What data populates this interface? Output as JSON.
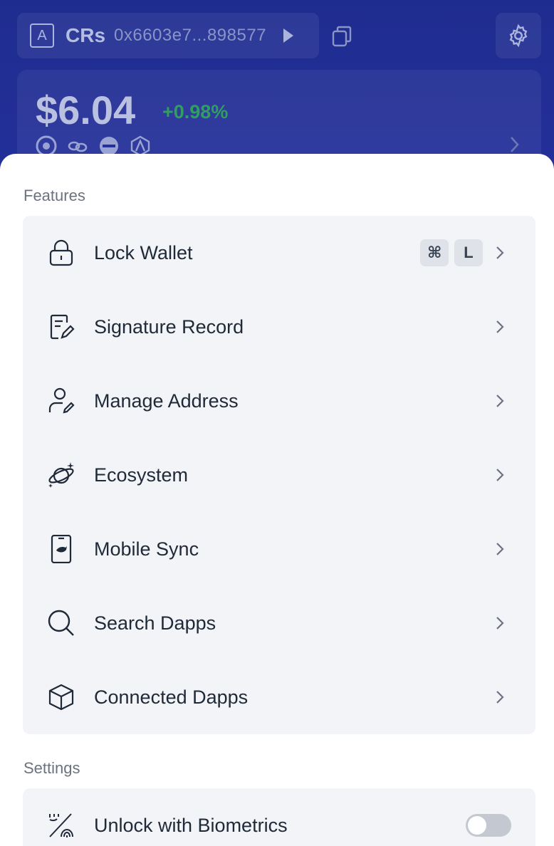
{
  "header": {
    "account_badge": "A",
    "account_name": "CRs",
    "account_address": "0x6603e7...898577",
    "balance": "$6.04",
    "change": "+0.98%"
  },
  "features": {
    "title": "Features",
    "items": [
      {
        "label": "Lock Wallet",
        "icon": "lock-icon",
        "shortcut": [
          "⌘",
          "L"
        ]
      },
      {
        "label": "Signature Record",
        "icon": "signature-record-icon"
      },
      {
        "label": "Manage Address",
        "icon": "user-edit-icon"
      },
      {
        "label": "Ecosystem",
        "icon": "planet-icon"
      },
      {
        "label": "Mobile Sync",
        "icon": "mobile-icon"
      },
      {
        "label": "Search Dapps",
        "icon": "search-icon"
      },
      {
        "label": "Connected Dapps",
        "icon": "cube-icon"
      }
    ]
  },
  "settings": {
    "title": "Settings",
    "items": [
      {
        "label": "Unlock with Biometrics",
        "icon": "fingerprint-icon",
        "toggle_on": false
      }
    ]
  },
  "colors": {
    "header_bg": "#1f2c8f",
    "positive": "#2e9f5e",
    "group_bg": "#f2f4f7",
    "text": "#1f2937",
    "muted": "#6b7280"
  }
}
